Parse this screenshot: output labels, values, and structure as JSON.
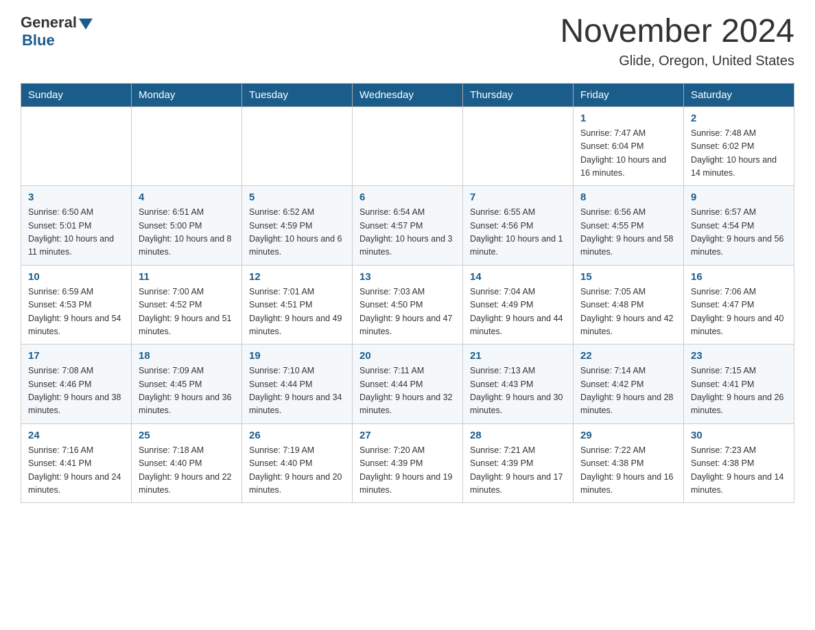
{
  "header": {
    "logo_text_general": "General",
    "logo_text_blue": "Blue",
    "month_title": "November 2024",
    "location": "Glide, Oregon, United States"
  },
  "days_of_week": [
    "Sunday",
    "Monday",
    "Tuesday",
    "Wednesday",
    "Thursday",
    "Friday",
    "Saturday"
  ],
  "weeks": [
    [
      {
        "day": "",
        "info": ""
      },
      {
        "day": "",
        "info": ""
      },
      {
        "day": "",
        "info": ""
      },
      {
        "day": "",
        "info": ""
      },
      {
        "day": "",
        "info": ""
      },
      {
        "day": "1",
        "info": "Sunrise: 7:47 AM\nSunset: 6:04 PM\nDaylight: 10 hours and 16 minutes."
      },
      {
        "day": "2",
        "info": "Sunrise: 7:48 AM\nSunset: 6:02 PM\nDaylight: 10 hours and 14 minutes."
      }
    ],
    [
      {
        "day": "3",
        "info": "Sunrise: 6:50 AM\nSunset: 5:01 PM\nDaylight: 10 hours and 11 minutes."
      },
      {
        "day": "4",
        "info": "Sunrise: 6:51 AM\nSunset: 5:00 PM\nDaylight: 10 hours and 8 minutes."
      },
      {
        "day": "5",
        "info": "Sunrise: 6:52 AM\nSunset: 4:59 PM\nDaylight: 10 hours and 6 minutes."
      },
      {
        "day": "6",
        "info": "Sunrise: 6:54 AM\nSunset: 4:57 PM\nDaylight: 10 hours and 3 minutes."
      },
      {
        "day": "7",
        "info": "Sunrise: 6:55 AM\nSunset: 4:56 PM\nDaylight: 10 hours and 1 minute."
      },
      {
        "day": "8",
        "info": "Sunrise: 6:56 AM\nSunset: 4:55 PM\nDaylight: 9 hours and 58 minutes."
      },
      {
        "day": "9",
        "info": "Sunrise: 6:57 AM\nSunset: 4:54 PM\nDaylight: 9 hours and 56 minutes."
      }
    ],
    [
      {
        "day": "10",
        "info": "Sunrise: 6:59 AM\nSunset: 4:53 PM\nDaylight: 9 hours and 54 minutes."
      },
      {
        "day": "11",
        "info": "Sunrise: 7:00 AM\nSunset: 4:52 PM\nDaylight: 9 hours and 51 minutes."
      },
      {
        "day": "12",
        "info": "Sunrise: 7:01 AM\nSunset: 4:51 PM\nDaylight: 9 hours and 49 minutes."
      },
      {
        "day": "13",
        "info": "Sunrise: 7:03 AM\nSunset: 4:50 PM\nDaylight: 9 hours and 47 minutes."
      },
      {
        "day": "14",
        "info": "Sunrise: 7:04 AM\nSunset: 4:49 PM\nDaylight: 9 hours and 44 minutes."
      },
      {
        "day": "15",
        "info": "Sunrise: 7:05 AM\nSunset: 4:48 PM\nDaylight: 9 hours and 42 minutes."
      },
      {
        "day": "16",
        "info": "Sunrise: 7:06 AM\nSunset: 4:47 PM\nDaylight: 9 hours and 40 minutes."
      }
    ],
    [
      {
        "day": "17",
        "info": "Sunrise: 7:08 AM\nSunset: 4:46 PM\nDaylight: 9 hours and 38 minutes."
      },
      {
        "day": "18",
        "info": "Sunrise: 7:09 AM\nSunset: 4:45 PM\nDaylight: 9 hours and 36 minutes."
      },
      {
        "day": "19",
        "info": "Sunrise: 7:10 AM\nSunset: 4:44 PM\nDaylight: 9 hours and 34 minutes."
      },
      {
        "day": "20",
        "info": "Sunrise: 7:11 AM\nSunset: 4:44 PM\nDaylight: 9 hours and 32 minutes."
      },
      {
        "day": "21",
        "info": "Sunrise: 7:13 AM\nSunset: 4:43 PM\nDaylight: 9 hours and 30 minutes."
      },
      {
        "day": "22",
        "info": "Sunrise: 7:14 AM\nSunset: 4:42 PM\nDaylight: 9 hours and 28 minutes."
      },
      {
        "day": "23",
        "info": "Sunrise: 7:15 AM\nSunset: 4:41 PM\nDaylight: 9 hours and 26 minutes."
      }
    ],
    [
      {
        "day": "24",
        "info": "Sunrise: 7:16 AM\nSunset: 4:41 PM\nDaylight: 9 hours and 24 minutes."
      },
      {
        "day": "25",
        "info": "Sunrise: 7:18 AM\nSunset: 4:40 PM\nDaylight: 9 hours and 22 minutes."
      },
      {
        "day": "26",
        "info": "Sunrise: 7:19 AM\nSunset: 4:40 PM\nDaylight: 9 hours and 20 minutes."
      },
      {
        "day": "27",
        "info": "Sunrise: 7:20 AM\nSunset: 4:39 PM\nDaylight: 9 hours and 19 minutes."
      },
      {
        "day": "28",
        "info": "Sunrise: 7:21 AM\nSunset: 4:39 PM\nDaylight: 9 hours and 17 minutes."
      },
      {
        "day": "29",
        "info": "Sunrise: 7:22 AM\nSunset: 4:38 PM\nDaylight: 9 hours and 16 minutes."
      },
      {
        "day": "30",
        "info": "Sunrise: 7:23 AM\nSunset: 4:38 PM\nDaylight: 9 hours and 14 minutes."
      }
    ]
  ]
}
